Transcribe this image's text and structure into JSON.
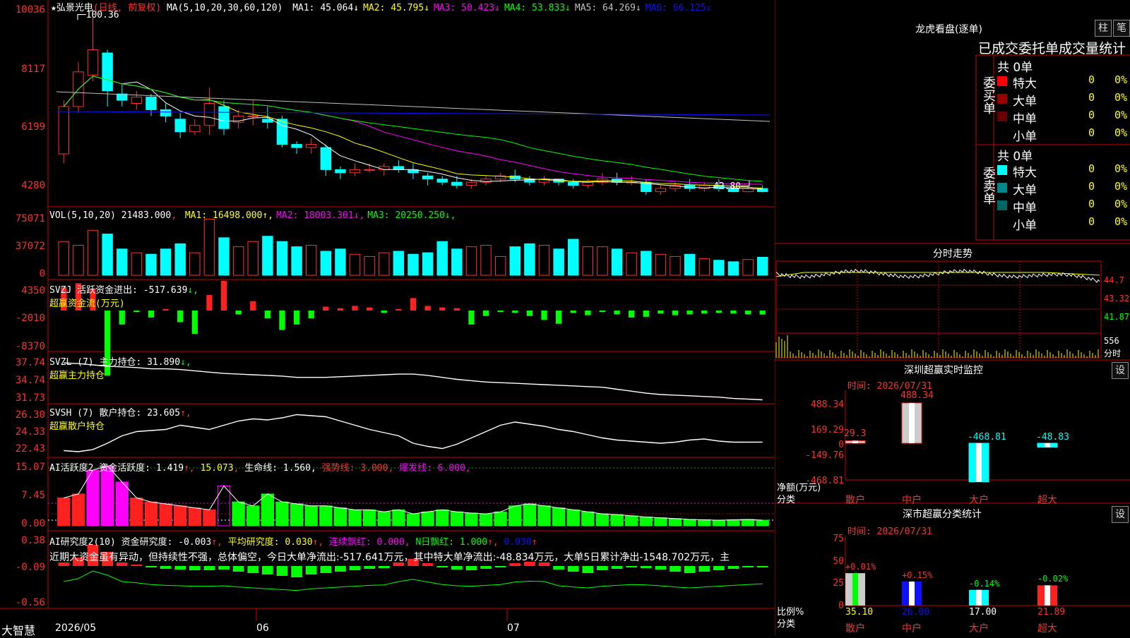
{
  "stock": {
    "name": "弘景光电",
    "period": "(日线, 前复权)",
    "ma_label": "MA(5,10,20,30,60,120)",
    "ma": [
      {
        "label": "MA1:",
        "value": "45.064",
        "arrow": "↓",
        "color": "#ffffff"
      },
      {
        "label": "MA2:",
        "value": "45.795",
        "arrow": "↓",
        "color": "#ffff00"
      },
      {
        "label": "MA3:",
        "value": "50.423",
        "arrow": "↓",
        "color": "#ff00ff"
      },
      {
        "label": "MA4:",
        "value": "53.833",
        "arrow": "↓",
        "color": "#00ff00"
      },
      {
        "label": "MA5:",
        "value": "64.269",
        "arrow": "↓",
        "color": "#c0c0c0"
      },
      {
        "label": "MA6:",
        "value": "66.125",
        "arrow": "↓",
        "color": "#1010ff"
      }
    ],
    "y_labels": [
      "10036",
      "8117",
      "6199",
      "4280"
    ],
    "high_label": "100.36",
    "low_label": "42.80"
  },
  "volume": {
    "title": "VOL(5,10,20)",
    "value": "21483.000",
    "ma": [
      {
        "label": "MA1:",
        "value": "16498.000",
        "arrow": "↑",
        "color": "#ffff00"
      },
      {
        "label": "MA2:",
        "value": "18003.301",
        "arrow": "↓",
        "color": "#ff00ff"
      },
      {
        "label": "MA3:",
        "value": "20250.250",
        "arrow": "↓",
        "color": "#00ff00"
      }
    ],
    "y_labels": [
      "75071",
      "37072",
      "0"
    ]
  },
  "svzj": {
    "title": "SVZJ  活跃资金进出:",
    "value": "-517.639",
    "arrow": "↓,",
    "sub": "超赢资金流(万元)",
    "y_labels": [
      "4350",
      "-2010",
      "-8370"
    ]
  },
  "svzl": {
    "title": "SVZL (7) 主力持仓:",
    "value": "31.890",
    "arrow": "↓,",
    "sub": "超赢主力持仓",
    "y_labels": [
      "37.74",
      "34.74",
      "31.73"
    ]
  },
  "svsh": {
    "title": "SVSH (7) 散户持仓:",
    "value": "23.605",
    "arrow": "↑,",
    "sub": "超赢散户持仓",
    "y_labels": [
      "26.30",
      "24.33",
      "22.43"
    ]
  },
  "ai_active": {
    "title": "AI活跃度2 资金活跃度:",
    "value": "1.419",
    "arrow": "↑,",
    "v2": "15.073",
    "life_label": "生命线:",
    "life_value": "1.560",
    "strong_label": "强势线:",
    "strong_value": "3.000",
    "burst_label": "爆发线:",
    "burst_value": "6.000,",
    "y_labels": [
      "15.07",
      "7.45",
      "0.00"
    ]
  },
  "ai_research": {
    "title": "AI研究度2(10) 资金研究度:",
    "value": "-0.003",
    "avg_label": "平均研究度:",
    "avg_value": "0.030",
    "cont_label": "连续飘红:",
    "cont_value": "0.000,",
    "nday_label": "N日飘红:",
    "nday_value": "1.000",
    "last_value": "0.030",
    "summary": "近期大资金虽有异动，但持续性不强，总体偏空，今日大单净流出:-517.641万元，其中特大单净流出:-48.834万元，大单5日累计净出-1548.702万元，主",
    "y_labels": [
      "0.38",
      "-0.09",
      "-0.56"
    ]
  },
  "footer": {
    "brand": "大智慧",
    "dates": [
      "2026/05",
      "06",
      "07"
    ]
  },
  "right_panel": {
    "title": "龙虎看盘(逐单)",
    "btn_zhu": "柱",
    "btn_bi": "笔",
    "header": "已成交委托单成交量统计",
    "buy": {
      "side": "委买单",
      "total": "共 0单",
      "rows": [
        {
          "label": "特大",
          "count": "0",
          "pct": "0%",
          "color": "#ff0000"
        },
        {
          "label": "大单",
          "count": "0",
          "pct": "0%",
          "color": "#990000"
        },
        {
          "label": "中单",
          "count": "0",
          "pct": "0%",
          "color": "#660000"
        },
        {
          "label": "小单",
          "count": "0",
          "pct": "0%",
          "color": ""
        }
      ]
    },
    "sell": {
      "side": "委卖单",
      "total": "共 0单",
      "rows": [
        {
          "label": "特大",
          "count": "0",
          "pct": "0%",
          "color": "#00ffff"
        },
        {
          "label": "大单",
          "count": "0",
          "pct": "0%",
          "color": "#008888"
        },
        {
          "label": "中单",
          "count": "0",
          "pct": "0%",
          "color": "#006666"
        },
        {
          "label": "小单",
          "count": "0",
          "pct": "0%",
          "color": ""
        }
      ]
    },
    "intraday": {
      "title": "分时走势",
      "y_labels": [
        "44.7",
        "43.32",
        "41.87",
        "556",
        "分时"
      ]
    },
    "sz_monitor": {
      "title": "深圳超赢实时监控",
      "btn": "设",
      "time": "时间: 2026/07/31",
      "y_labels": [
        "488.34",
        "169.29",
        "0",
        "-149.76",
        "-468.81"
      ],
      "y_unit": "净额(万元)",
      "x_unit": "分类",
      "bars": [
        {
          "label": "散户",
          "value": 29.3,
          "text": "29.3"
        },
        {
          "label": "中户",
          "value": 488.34,
          "text": "488.34"
        },
        {
          "label": "大户",
          "value": -468.81,
          "text": "-468.81"
        },
        {
          "label": "超大",
          "value": -48.83,
          "text": "-48.83"
        }
      ]
    },
    "class_stat": {
      "title": "深市超赢分类统计",
      "btn": "设",
      "time": "时间: 2026/07/31",
      "y_labels": [
        "75",
        "50",
        "25",
        "0"
      ],
      "y_unit": "比例%",
      "x_unit": "分类",
      "bars": [
        {
          "label": "散户",
          "value": 35.1,
          "text": "35.10",
          "change": "+0.01%"
        },
        {
          "label": "中户",
          "value": 26.0,
          "text": "26.00",
          "change": "+0.15%"
        },
        {
          "label": "大户",
          "value": 17.0,
          "text": "17.00",
          "change": "-0.14%"
        },
        {
          "label": "超大",
          "value": 21.89,
          "text": "21.89",
          "change": "-0.02%"
        }
      ]
    }
  },
  "chart_data": {
    "type": "candlestick",
    "candles": [
      [
        55,
        70,
        72,
        52
      ],
      [
        70,
        81,
        84,
        68
      ],
      [
        80,
        88,
        100.36,
        78
      ],
      [
        87,
        75,
        88,
        70
      ],
      [
        74,
        72,
        77,
        70
      ],
      [
        71,
        73,
        75,
        69
      ],
      [
        73,
        69,
        74,
        67
      ],
      [
        69,
        67,
        71,
        65
      ],
      [
        66,
        62,
        68,
        60
      ],
      [
        62,
        64,
        66,
        61
      ],
      [
        64,
        71,
        76,
        61
      ],
      [
        70,
        63,
        72,
        61
      ],
      [
        65,
        67,
        69,
        63
      ],
      [
        67,
        67,
        72,
        64
      ],
      [
        66,
        65,
        70,
        63
      ],
      [
        66,
        58,
        67,
        57
      ],
      [
        58,
        57,
        59,
        55
      ],
      [
        57,
        58,
        60,
        55
      ],
      [
        57,
        50,
        58,
        48
      ],
      [
        50,
        49,
        51,
        47
      ],
      [
        49,
        50,
        52,
        48
      ],
      [
        50,
        50,
        52,
        49
      ],
      [
        50,
        51,
        52,
        48
      ],
      [
        51,
        50,
        53,
        49
      ],
      [
        50,
        49,
        52,
        47
      ],
      [
        48,
        47,
        49,
        45
      ],
      [
        47,
        46,
        48,
        45
      ],
      [
        46,
        45,
        48,
        44
      ],
      [
        45,
        46,
        47,
        44
      ],
      [
        46,
        47,
        48,
        45
      ],
      [
        47,
        48,
        49,
        46
      ],
      [
        48,
        47,
        50,
        46
      ],
      [
        47,
        46,
        48,
        45
      ],
      [
        46,
        47,
        48,
        45
      ],
      [
        47,
        46,
        47,
        45
      ],
      [
        46,
        45,
        47,
        44
      ],
      [
        45,
        46,
        47,
        44
      ],
      [
        46,
        47,
        49,
        45
      ],
      [
        47,
        46,
        49,
        45
      ],
      [
        46,
        46,
        48,
        45
      ],
      [
        46,
        43,
        47,
        42
      ],
      [
        43,
        44,
        45,
        42
      ],
      [
        44,
        45,
        46,
        43
      ],
      [
        45,
        44,
        47,
        43
      ],
      [
        44,
        45,
        46,
        43
      ],
      [
        45,
        44,
        47,
        43
      ],
      [
        44,
        43,
        45,
        42.8
      ],
      [
        43,
        44,
        45,
        42.8
      ],
      [
        44,
        43,
        45,
        42.8
      ]
    ],
    "volumes": [
      45,
      40,
      60,
      55,
      35,
      30,
      28,
      35,
      42,
      30,
      75,
      50,
      38,
      45,
      52,
      45,
      38,
      40,
      32,
      35,
      28,
      25,
      30,
      32,
      28,
      30,
      45,
      35,
      38,
      40,
      25,
      38,
      42,
      40,
      35,
      48,
      38,
      38,
      35,
      30,
      32,
      28,
      25,
      28,
      22,
      20,
      18,
      21,
      24
    ],
    "svzj": [
      3000,
      3500,
      2800,
      -8370,
      -1800,
      -200,
      -900,
      200,
      -1500,
      -3000,
      2000,
      3800,
      -500,
      1200,
      -1000,
      -2500,
      -1800,
      -1000,
      500,
      300,
      600,
      400,
      -300,
      200,
      1600,
      600,
      400,
      300,
      -1800,
      -700,
      -200,
      -300,
      -700,
      -1200,
      -1700,
      -300,
      -600,
      -200,
      -500,
      -900,
      -800,
      -400,
      -600,
      -500,
      -400,
      -300,
      -400,
      -500,
      -517
    ],
    "svzl": [
      37.5,
      37.4,
      37.2,
      37.0,
      36.9,
      36.8,
      36.6,
      36.6,
      36.5,
      36.3,
      36.1,
      35.9,
      35.8,
      35.7,
      35.6,
      35.5,
      35.3,
      35.3,
      35.3,
      35.4,
      35.5,
      35.6,
      35.7,
      35.8,
      35.8,
      35.6,
      35.3,
      35.0,
      34.8,
      34.6,
      34.5,
      34.4,
      34.3,
      34.2,
      34.1,
      34.0,
      33.9,
      33.8,
      33.5,
      33.2,
      32.9,
      32.7,
      32.6,
      32.5,
      32.4,
      32.3,
      32.1,
      32.0,
      31.89
    ],
    "svsh": [
      22.8,
      22.7,
      22.9,
      23.5,
      24.2,
      24.6,
      24.7,
      24.8,
      25.2,
      25.0,
      24.8,
      25.2,
      25.6,
      25.8,
      25.7,
      25.9,
      26.2,
      26.1,
      26.0,
      25.6,
      25.2,
      24.8,
      24.5,
      24.2,
      23.5,
      23.2,
      23.0,
      23.4,
      24.0,
      24.6,
      25.2,
      25.5,
      25.3,
      25.1,
      24.8,
      24.6,
      24.3,
      24.0,
      23.8,
      23.7,
      23.6,
      23.5,
      23.6,
      23.8,
      23.9,
      23.7,
      23.6,
      23.6,
      23.605
    ],
    "active": [
      7.0,
      8.0,
      14.0,
      15.07,
      11.0,
      7.0,
      6.0,
      5.5,
      5.0,
      4.5,
      4.0,
      10.0,
      6.0,
      5.0,
      8.0,
      6.0,
      5.5,
      5.0,
      5.0,
      4.5,
      4.0,
      4.0,
      3.5,
      4.0,
      3.0,
      3.5,
      4.0,
      3.5,
      3.2,
      3.0,
      3.5,
      5.0,
      5.5,
      5.0,
      4.5,
      4.0,
      3.5,
      3.0,
      2.8,
      2.5,
      2.2,
      2.0,
      1.8,
      1.6,
      1.5,
      1.4,
      1.5,
      1.6,
      1.419
    ],
    "research": [
      0.05,
      0.12,
      0.3,
      0.2,
      0.05,
      0.02,
      -0.02,
      -0.04,
      -0.05,
      -0.06,
      -0.06,
      -0.05,
      -0.08,
      -0.1,
      -0.12,
      -0.14,
      -0.16,
      -0.12,
      -0.1,
      -0.08,
      -0.06,
      -0.04,
      -0.03,
      0.05,
      0.1,
      0.04,
      -0.02,
      -0.05,
      -0.06,
      -0.04,
      -0.02,
      0.04,
      0.06,
      0.05,
      -0.05,
      -0.08,
      -0.1,
      -0.06,
      -0.04,
      -0.02,
      -0.03,
      -0.05,
      -0.08,
      -0.1,
      -0.08,
      -0.06,
      -0.04,
      -0.02,
      -0.003
    ]
  }
}
